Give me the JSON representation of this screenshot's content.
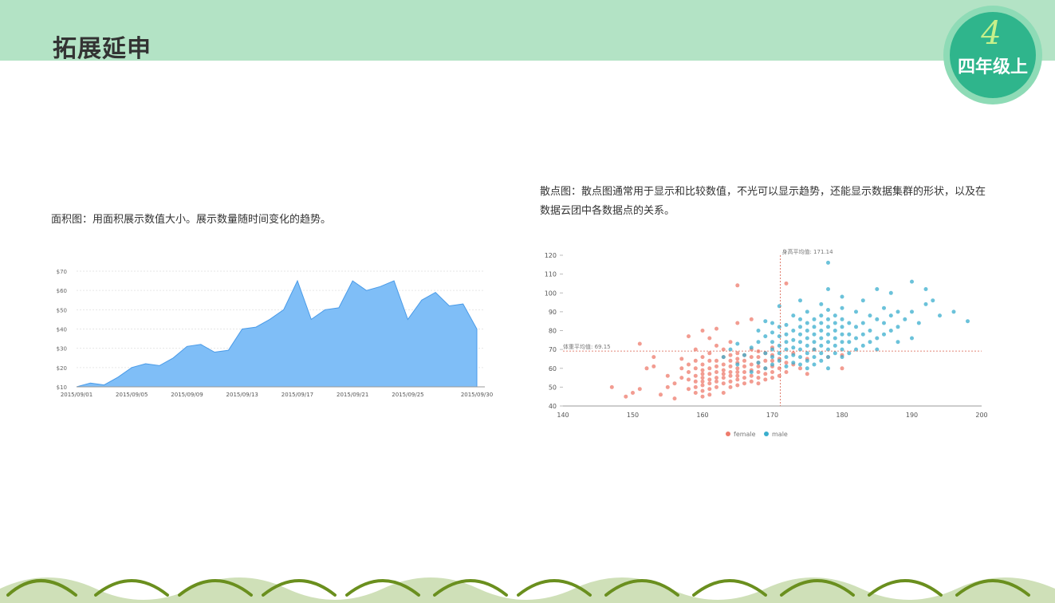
{
  "page": {
    "title": "拓展延申",
    "badge_digit": "4",
    "badge_text": "四年级上"
  },
  "descriptions": {
    "area": "面积图：用面积展示数值大小。展示数量随时间变化的趋势。",
    "scatter": "散点图：散点图通常用于显示和比较数值，不光可以显示趋势，还能显示数据集群的形状，以及在数据云团中各数据点的关系。"
  },
  "colors": {
    "band": "#b3e3c5",
    "badge_outer": "#8edbb6",
    "badge_inner": "#2fb58c",
    "area_fill": "#7fbef7",
    "area_line": "#4a9be8",
    "female": "#ee7b6c",
    "male": "#3aaecd",
    "wave": "#6a8f1e"
  },
  "chart_data": [
    {
      "type": "area",
      "ylim": [
        10,
        70
      ],
      "y_ticks": [
        "$10",
        "$20",
        "$30",
        "$40",
        "$50",
        "$60",
        "$70"
      ],
      "x_tick_labels": [
        "2015/09/01",
        "2015/09/05",
        "2015/09/09",
        "2015/09/13",
        "2015/09/17",
        "2015/09/21",
        "2015/09/25",
        "2015/09/30"
      ],
      "x_tick_index": [
        0,
        4,
        8,
        12,
        16,
        20,
        24,
        29
      ],
      "grid": true,
      "values": [
        10,
        12,
        11,
        15,
        20,
        22,
        21,
        25,
        31,
        32,
        28,
        29,
        40,
        41,
        45,
        50,
        65,
        45,
        50,
        51,
        65,
        60,
        62,
        65,
        45,
        55,
        59,
        52,
        53,
        40
      ]
    },
    {
      "type": "scatter",
      "xlim": [
        140,
        200
      ],
      "ylim": [
        40,
        120
      ],
      "x_ticks": [
        "140",
        "150",
        "160",
        "170",
        "180",
        "190",
        "200"
      ],
      "y_ticks": [
        "40",
        "50",
        "60",
        "70",
        "80",
        "90",
        "100",
        "110",
        "120"
      ],
      "legend_position": "bottom",
      "series": [
        {
          "name": "female",
          "color": "#ee7b6c",
          "points": [
            [
              147,
              50
            ],
            [
              149,
              45
            ],
            [
              150,
              47
            ],
            [
              151,
              49
            ],
            [
              151,
              73
            ],
            [
              152,
              60
            ],
            [
              153,
              61
            ],
            [
              153,
              66
            ],
            [
              154,
              46
            ],
            [
              155,
              56
            ],
            [
              155,
              50
            ],
            [
              156,
              44
            ],
            [
              156,
              52
            ],
            [
              157,
              55
            ],
            [
              157,
              60
            ],
            [
              157,
              65
            ],
            [
              158,
              49
            ],
            [
              158,
              54
            ],
            [
              158,
              58
            ],
            [
              158,
              62
            ],
            [
              158,
              77
            ],
            [
              159,
              47
            ],
            [
              159,
              50
            ],
            [
              159,
              53
            ],
            [
              159,
              56
            ],
            [
              159,
              60
            ],
            [
              159,
              64
            ],
            [
              159,
              70
            ],
            [
              160,
              45
            ],
            [
              160,
              48
            ],
            [
              160,
              51
            ],
            [
              160,
              53
            ],
            [
              160,
              55
            ],
            [
              160,
              57
            ],
            [
              160,
              59
            ],
            [
              160,
              62
            ],
            [
              160,
              66
            ],
            [
              160,
              80
            ],
            [
              161,
              46
            ],
            [
              161,
              49
            ],
            [
              161,
              52
            ],
            [
              161,
              54
            ],
            [
              161,
              57
            ],
            [
              161,
              60
            ],
            [
              161,
              64
            ],
            [
              161,
              68
            ],
            [
              161,
              76
            ],
            [
              162,
              50
            ],
            [
              162,
              53
            ],
            [
              162,
              55
            ],
            [
              162,
              58
            ],
            [
              162,
              61
            ],
            [
              162,
              64
            ],
            [
              162,
              72
            ],
            [
              162,
              81
            ],
            [
              163,
              47
            ],
            [
              163,
              52
            ],
            [
              163,
              55
            ],
            [
              163,
              57
            ],
            [
              163,
              59
            ],
            [
              163,
              62
            ],
            [
              163,
              66
            ],
            [
              163,
              70
            ],
            [
              164,
              50
            ],
            [
              164,
              53
            ],
            [
              164,
              56
            ],
            [
              164,
              58
            ],
            [
              164,
              61
            ],
            [
              164,
              64
            ],
            [
              164,
              67
            ],
            [
              164,
              74
            ],
            [
              165,
              51
            ],
            [
              165,
              54
            ],
            [
              165,
              56
            ],
            [
              165,
              58
            ],
            [
              165,
              60
            ],
            [
              165,
              63
            ],
            [
              165,
              65
            ],
            [
              165,
              68
            ],
            [
              165,
              84
            ],
            [
              165,
              104
            ],
            [
              166,
              52
            ],
            [
              166,
              55
            ],
            [
              166,
              58
            ],
            [
              166,
              61
            ],
            [
              166,
              64
            ],
            [
              166,
              67
            ],
            [
              167,
              53
            ],
            [
              167,
              56
            ],
            [
              167,
              59
            ],
            [
              167,
              62
            ],
            [
              167,
              66
            ],
            [
              167,
              70
            ],
            [
              167,
              86
            ],
            [
              168,
              52
            ],
            [
              168,
              55
            ],
            [
              168,
              58
            ],
            [
              168,
              61
            ],
            [
              168,
              63
            ],
            [
              168,
              66
            ],
            [
              168,
              69
            ],
            [
              169,
              54
            ],
            [
              169,
              57
            ],
            [
              169,
              60
            ],
            [
              169,
              64
            ],
            [
              169,
              68
            ],
            [
              170,
              55
            ],
            [
              170,
              58
            ],
            [
              170,
              61
            ],
            [
              170,
              64
            ],
            [
              170,
              67
            ],
            [
              170,
              71
            ],
            [
              171,
              56
            ],
            [
              171,
              60
            ],
            [
              171,
              65
            ],
            [
              172,
              58
            ],
            [
              172,
              63
            ],
            [
              172,
              105
            ],
            [
              173,
              62
            ],
            [
              173,
              68
            ],
            [
              174,
              60
            ],
            [
              175,
              57
            ],
            [
              175,
              65
            ],
            [
              176,
              70
            ],
            [
              178,
              66
            ],
            [
              180,
              67
            ],
            [
              180,
              60
            ]
          ]
        },
        {
          "name": "male",
          "color": "#3aaecd",
          "points": [
            [
              163,
              66
            ],
            [
              164,
              70
            ],
            [
              165,
              73
            ],
            [
              165,
              62
            ],
            [
              166,
              67
            ],
            [
              167,
              71
            ],
            [
              167,
              58
            ],
            [
              168,
              63
            ],
            [
              168,
              74
            ],
            [
              168,
              80
            ],
            [
              169,
              60
            ],
            [
              169,
              68
            ],
            [
              169,
              77
            ],
            [
              169,
              85
            ],
            [
              170,
              62
            ],
            [
              170,
              66
            ],
            [
              170,
              70
            ],
            [
              170,
              74
            ],
            [
              170,
              79
            ],
            [
              170,
              84
            ],
            [
              171,
              64
            ],
            [
              171,
              68
            ],
            [
              171,
              72
            ],
            [
              171,
              77
            ],
            [
              171,
              82
            ],
            [
              171,
              93
            ],
            [
              172,
              61
            ],
            [
              172,
              66
            ],
            [
              172,
              70
            ],
            [
              172,
              74
            ],
            [
              172,
              78
            ],
            [
              172,
              83
            ],
            [
              173,
              63
            ],
            [
              173,
              67
            ],
            [
              173,
              71
            ],
            [
              173,
              75
            ],
            [
              173,
              80
            ],
            [
              173,
              88
            ],
            [
              174,
              62
            ],
            [
              174,
              66
            ],
            [
              174,
              70
            ],
            [
              174,
              74
            ],
            [
              174,
              78
            ],
            [
              174,
              82
            ],
            [
              174,
              86
            ],
            [
              174,
              96
            ],
            [
              175,
              60
            ],
            [
              175,
              64
            ],
            [
              175,
              68
            ],
            [
              175,
              72
            ],
            [
              175,
              76
            ],
            [
              175,
              80
            ],
            [
              175,
              84
            ],
            [
              175,
              90
            ],
            [
              176,
              62
            ],
            [
              176,
              66
            ],
            [
              176,
              70
            ],
            [
              176,
              74
            ],
            [
              176,
              78
            ],
            [
              176,
              82
            ],
            [
              176,
              86
            ],
            [
              177,
              64
            ],
            [
              177,
              68
            ],
            [
              177,
              72
            ],
            [
              177,
              76
            ],
            [
              177,
              80
            ],
            [
              177,
              84
            ],
            [
              177,
              88
            ],
            [
              177,
              94
            ],
            [
              178,
              60
            ],
            [
              178,
              66
            ],
            [
              178,
              70
            ],
            [
              178,
              74
            ],
            [
              178,
              78
            ],
            [
              178,
              82
            ],
            [
              178,
              86
            ],
            [
              178,
              91
            ],
            [
              178,
              102
            ],
            [
              178,
              116
            ],
            [
              179,
              68
            ],
            [
              179,
              72
            ],
            [
              179,
              76
            ],
            [
              179,
              80
            ],
            [
              179,
              84
            ],
            [
              179,
              88
            ],
            [
              180,
              66
            ],
            [
              180,
              70
            ],
            [
              180,
              74
            ],
            [
              180,
              78
            ],
            [
              180,
              82
            ],
            [
              180,
              86
            ],
            [
              180,
              92
            ],
            [
              180,
              98
            ],
            [
              181,
              68
            ],
            [
              181,
              74
            ],
            [
              181,
              78
            ],
            [
              181,
              84
            ],
            [
              182,
              70
            ],
            [
              182,
              76
            ],
            [
              182,
              82
            ],
            [
              182,
              90
            ],
            [
              183,
              72
            ],
            [
              183,
              78
            ],
            [
              183,
              84
            ],
            [
              183,
              96
            ],
            [
              184,
              74
            ],
            [
              184,
              80
            ],
            [
              184,
              88
            ],
            [
              185,
              70
            ],
            [
              185,
              76
            ],
            [
              185,
              86
            ],
            [
              185,
              102
            ],
            [
              186,
              78
            ],
            [
              186,
              84
            ],
            [
              186,
              92
            ],
            [
              187,
              80
            ],
            [
              187,
              88
            ],
            [
              187,
              100
            ],
            [
              188,
              74
            ],
            [
              188,
              82
            ],
            [
              188,
              90
            ],
            [
              189,
              86
            ],
            [
              190,
              76
            ],
            [
              190,
              90
            ],
            [
              190,
              106
            ],
            [
              191,
              84
            ],
            [
              192,
              94
            ],
            [
              192,
              102
            ],
            [
              193,
              96
            ],
            [
              194,
              88
            ],
            [
              196,
              90
            ],
            [
              198,
              85
            ]
          ]
        }
      ],
      "ref_lines": [
        {
          "label": "身高平均值: 171.14",
          "axis": "x",
          "value": 171.14
        },
        {
          "label": "体重平均值: 69.15",
          "axis": "y",
          "value": 69.15
        }
      ]
    }
  ]
}
